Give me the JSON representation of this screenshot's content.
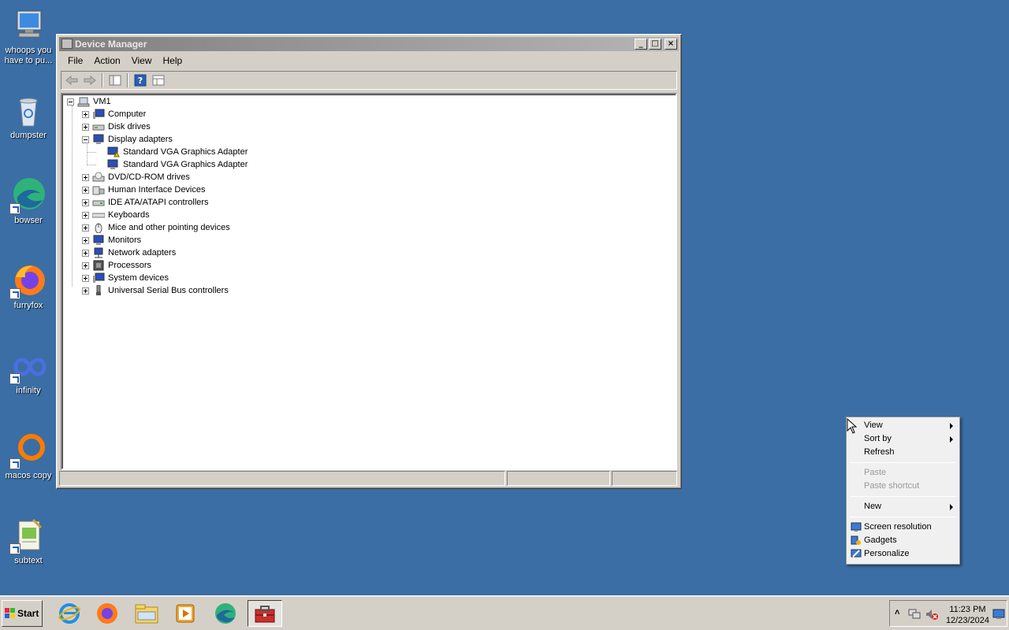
{
  "desktop": {
    "icons": [
      {
        "label": "whoops you have to pu...",
        "icon": "computer-icon"
      },
      {
        "label": "dumpster",
        "icon": "recycle-bin-icon"
      },
      {
        "label": "bowser",
        "icon": "edge-browser-icon"
      },
      {
        "label": "furryfox",
        "icon": "firefox-icon"
      },
      {
        "label": "infinity",
        "icon": "infinity-icon"
      },
      {
        "label": "macos copy",
        "icon": "orange-ring-icon"
      },
      {
        "label": "subtext",
        "icon": "notepad-icon"
      }
    ]
  },
  "window": {
    "title": "Device Manager",
    "menu": [
      "File",
      "Action",
      "View",
      "Help"
    ],
    "tree": {
      "root": "VM1",
      "nodes": [
        {
          "label": "Computer",
          "expanded": false
        },
        {
          "label": "Disk drives",
          "expanded": false
        },
        {
          "label": "Display adapters",
          "expanded": true,
          "children": [
            "Standard VGA Graphics Adapter",
            "Standard VGA Graphics Adapter"
          ]
        },
        {
          "label": "DVD/CD-ROM drives",
          "expanded": false
        },
        {
          "label": "Human Interface Devices",
          "expanded": false
        },
        {
          "label": "IDE ATA/ATAPI controllers",
          "expanded": false
        },
        {
          "label": "Keyboards",
          "expanded": false
        },
        {
          "label": "Mice and other pointing devices",
          "expanded": false
        },
        {
          "label": "Monitors",
          "expanded": false
        },
        {
          "label": "Network adapters",
          "expanded": false
        },
        {
          "label": "Processors",
          "expanded": false
        },
        {
          "label": "System devices",
          "expanded": false
        },
        {
          "label": "Universal Serial Bus controllers",
          "expanded": false
        }
      ]
    }
  },
  "context_menu": {
    "items": [
      {
        "label": "View",
        "submenu": true,
        "disabled": false
      },
      {
        "label": "Sort by",
        "submenu": true,
        "disabled": false
      },
      {
        "label": "Refresh",
        "submenu": false,
        "disabled": false
      },
      {
        "label": "Paste",
        "submenu": false,
        "disabled": true
      },
      {
        "label": "Paste shortcut",
        "submenu": false,
        "disabled": true
      },
      {
        "label": "New",
        "submenu": true,
        "disabled": false
      },
      {
        "label": "Screen resolution",
        "submenu": false,
        "disabled": false,
        "icon": "display-settings-icon"
      },
      {
        "label": "Gadgets",
        "submenu": false,
        "disabled": false,
        "icon": "gadgets-icon"
      },
      {
        "label": "Personalize",
        "submenu": false,
        "disabled": false,
        "icon": "personalize-icon"
      }
    ]
  },
  "taskbar": {
    "start_label": "Start",
    "clock_time": "11:23 PM",
    "clock_date": "12/23/2024"
  },
  "colors": {
    "desktop": "#3a6ea5",
    "chrome": "#d4d0c8"
  }
}
